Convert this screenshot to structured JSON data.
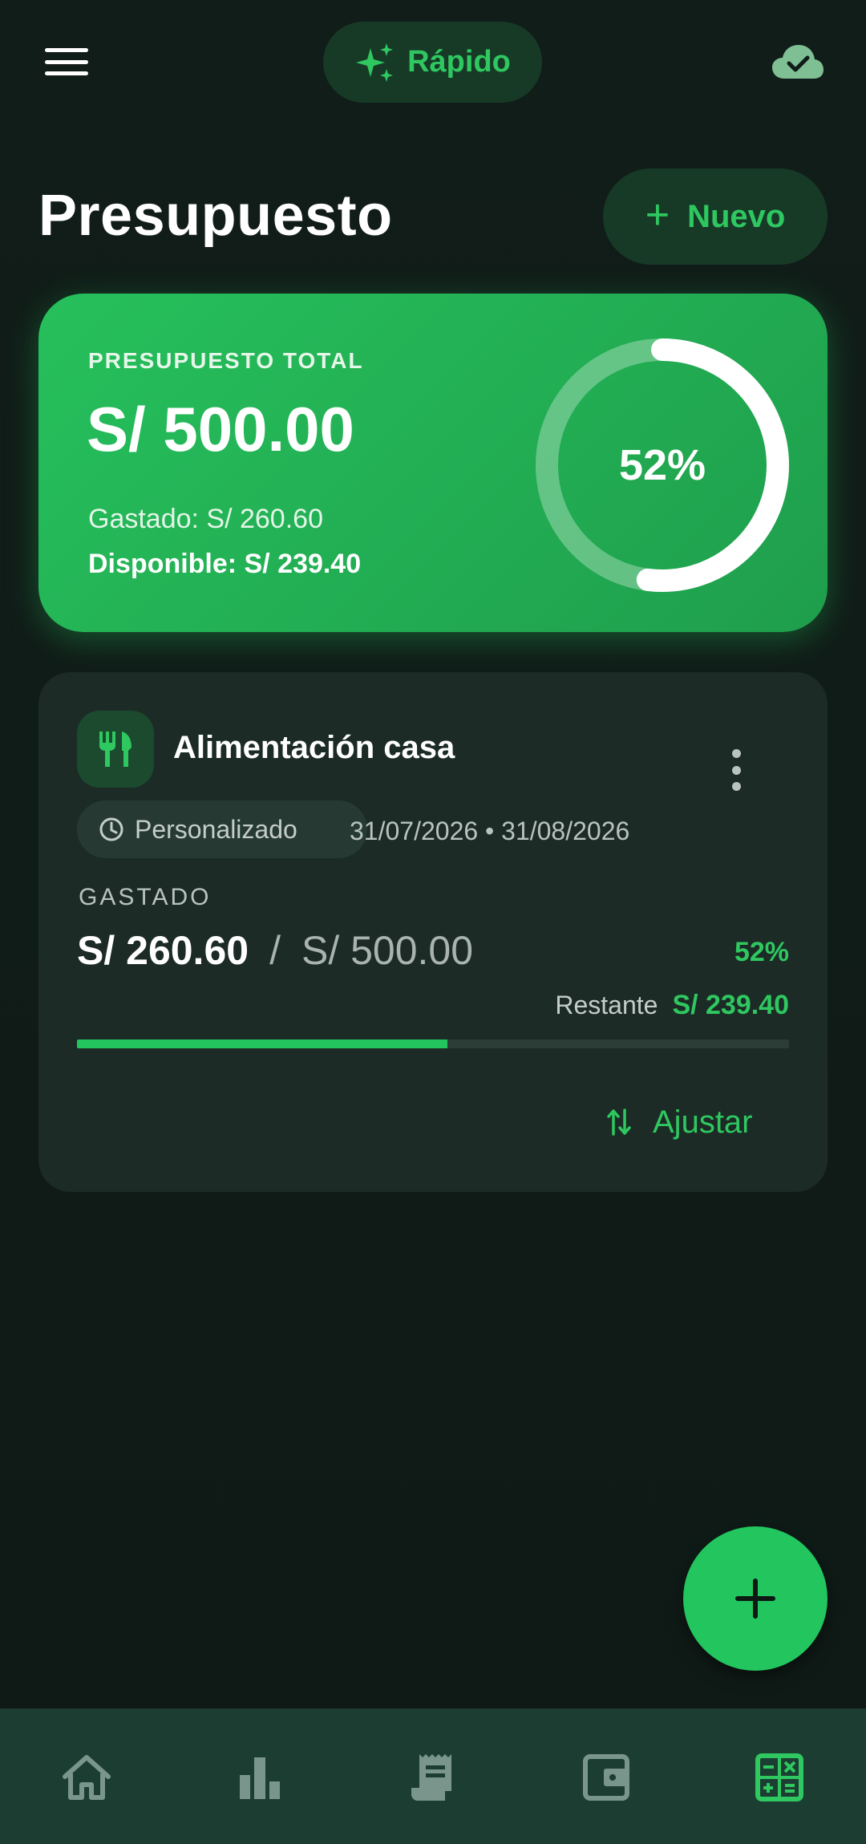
{
  "top_bar": {
    "quick_label": "Rápido",
    "menu_icon": "hamburger-menu-icon",
    "sync_icon": "cloud-check-icon"
  },
  "header": {
    "title": "Presupuesto",
    "new_button_label": "Nuevo"
  },
  "summary": {
    "label": "PRESUPUESTO TOTAL",
    "amount": "S/ 500.00",
    "spent": "Gastado: S/ 260.60",
    "available": "Disponible: S/ 239.40",
    "percent_label": "52%",
    "progress_fraction": 0.52
  },
  "budgets": [
    {
      "icon": "fork-knife-icon",
      "name": "Alimentación casa",
      "period_type": "Personalizado",
      "dates": "31/07/2026 • 31/08/2026",
      "spent_label": "GASTADO",
      "spent": "S/ 260.60",
      "separator": "/",
      "total": "S/ 500.00",
      "percent_label": "52%",
      "progress_fraction": 0.52,
      "remaining_label": "Restante",
      "remaining": "S/ 239.40",
      "adjust_label": "Ajustar"
    }
  ],
  "bottom_nav": [
    {
      "icon": "home-icon",
      "active": false
    },
    {
      "icon": "bar-chart-icon",
      "active": false
    },
    {
      "icon": "receipt-icon",
      "active": false
    },
    {
      "icon": "wallet-icon",
      "active": false
    },
    {
      "icon": "calculator-icon",
      "active": true
    }
  ],
  "colors": {
    "background": "#101c18",
    "accent": "#22c55e",
    "accent_text": "#2fc760",
    "card": "#1c2b26",
    "nav_background": "#1b3d32",
    "nav_icon_inactive": "#7a968c"
  }
}
